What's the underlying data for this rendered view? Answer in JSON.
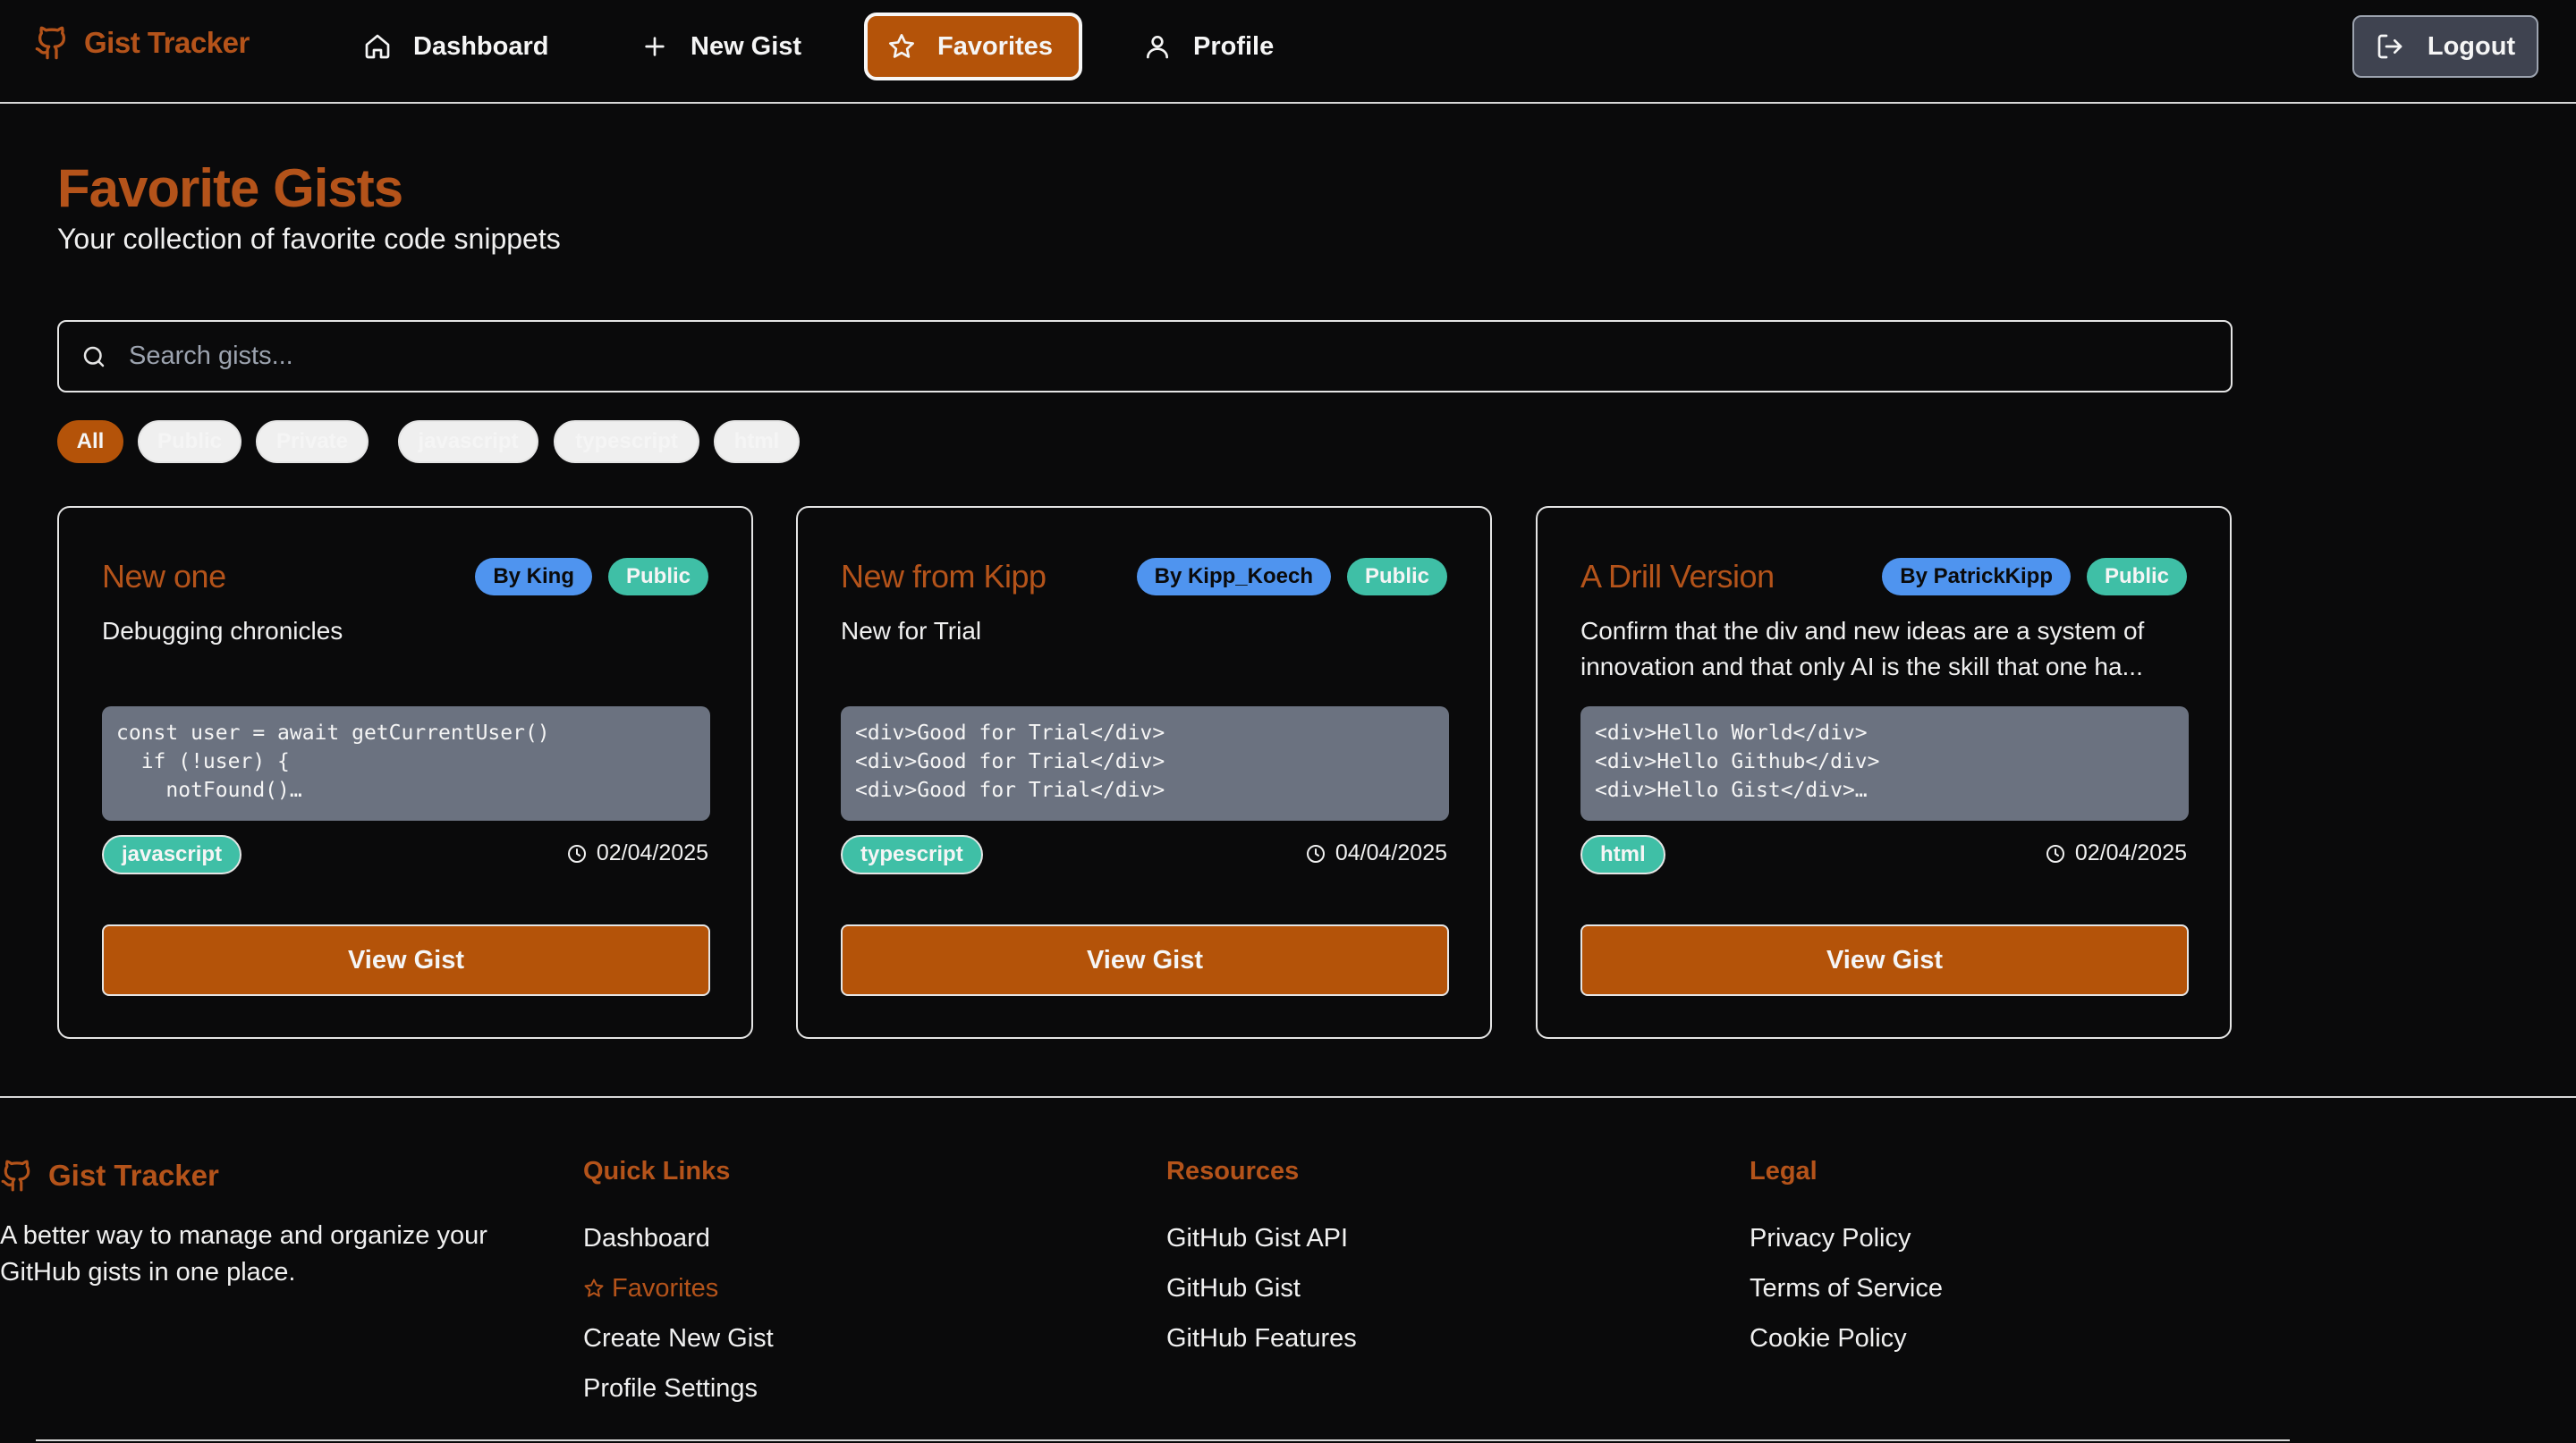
{
  "app": {
    "name": "Gist Tracker",
    "logo_icon": "github-icon"
  },
  "nav": {
    "items": [
      {
        "label": "Dashboard",
        "icon": "home-icon"
      },
      {
        "label": "New Gist",
        "icon": "plus-icon"
      },
      {
        "label": "Favorites",
        "icon": "star-icon",
        "active": true
      },
      {
        "label": "Profile",
        "icon": "user-icon"
      }
    ],
    "logout_label": "Logout"
  },
  "page": {
    "title": "Favorite Gists",
    "subtitle": "Your collection of favorite code snippets"
  },
  "search": {
    "placeholder": "Search gists..."
  },
  "filters": [
    "All",
    "Public",
    "Private",
    "javascript",
    "typescript",
    "html"
  ],
  "cards": [
    {
      "title": "New one",
      "author": "By King",
      "visibility": "Public",
      "description": "Debugging chronicles",
      "code": "const user = await getCurrentUser()\n  if (!user) {\n    notFound()…",
      "language": "javascript",
      "date": "02/04/2025",
      "button": "View Gist"
    },
    {
      "title": "New from Kipp",
      "author": "By Kipp_Koech",
      "visibility": "Public",
      "description": "New for Trial",
      "code": "<div>Good for Trial</div>\n<div>Good for Trial</div>\n<div>Good for Trial</div>",
      "language": "typescript",
      "date": "04/04/2025",
      "button": "View Gist"
    },
    {
      "title": "A Drill Version",
      "author": "By PatrickKipp",
      "visibility": "Public",
      "description": "Confirm that the div and new ideas are a system of innovation and that only AI is the skill that one ha...",
      "code": "<div>Hello World</div>\n<div>Hello Github</div>\n<div>Hello Gist</div>…",
      "language": "html",
      "date": "02/04/2025",
      "button": "View Gist"
    }
  ],
  "footer": {
    "brand": "Gist Tracker",
    "tagline": "A better way to manage and organize your GitHub gists in one place.",
    "columns": [
      {
        "heading": "Quick Links",
        "links": [
          "Dashboard",
          "Favorites",
          "Create New Gist",
          "Profile Settings"
        ]
      },
      {
        "heading": "Resources",
        "links": [
          "GitHub Gist API",
          "GitHub Gist",
          "GitHub Features"
        ]
      },
      {
        "heading": "Legal",
        "links": [
          "Privacy Policy",
          "Terms of Service",
          "Cookie Policy"
        ]
      }
    ]
  },
  "colors": {
    "accent": "#b45309",
    "teal": "#3fbfa6",
    "blue": "#4f94ef",
    "background": "#0a0a0b"
  }
}
